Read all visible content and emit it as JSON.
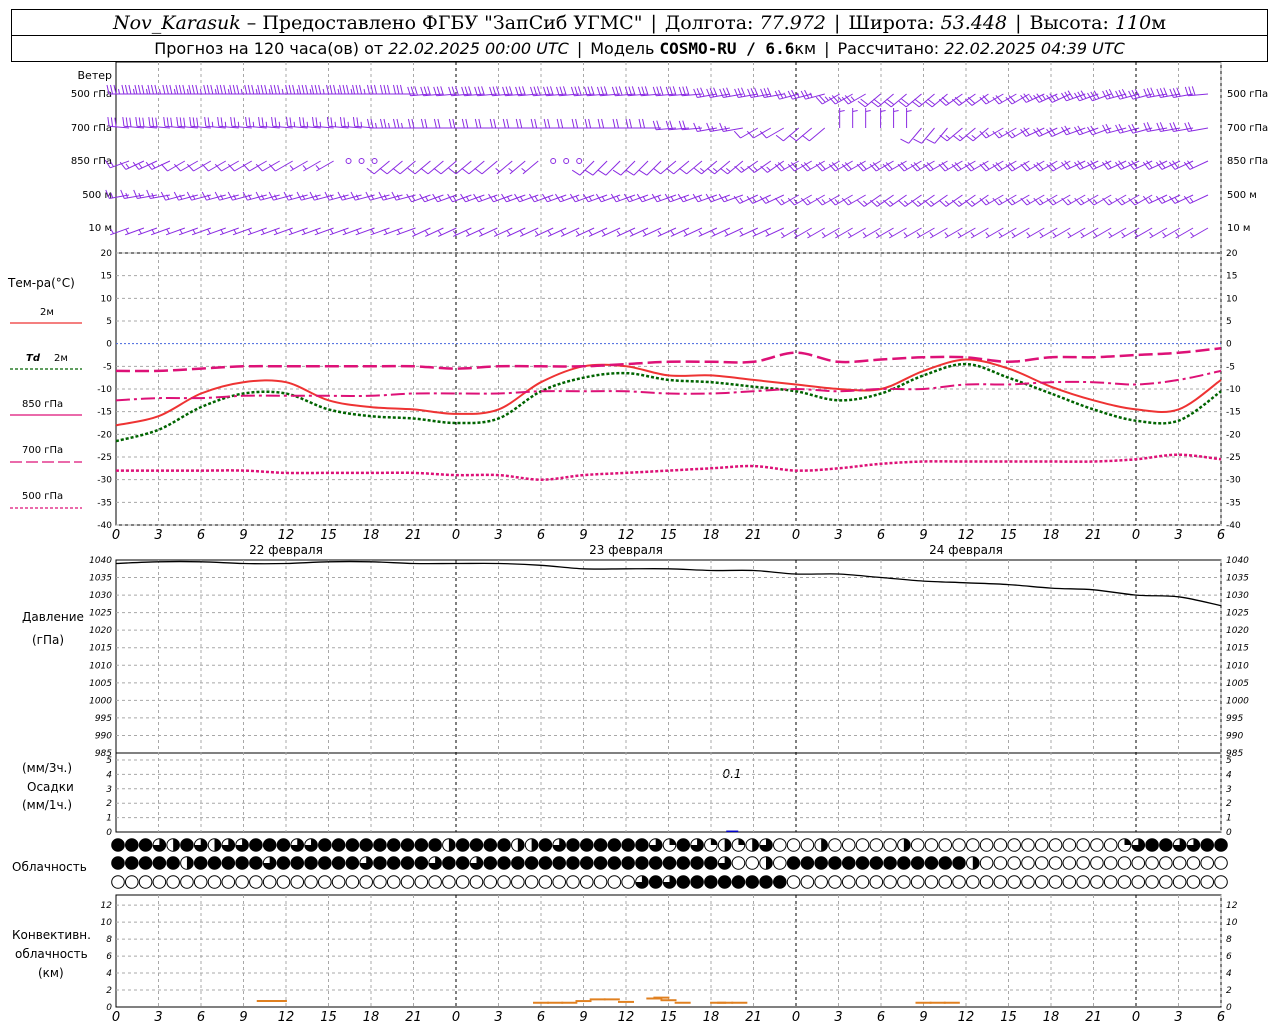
{
  "header": {
    "station": "Nov_Karasuk",
    "dash": " – ",
    "provider": "Предоставлено ФГБУ \"ЗапСиб УГМС\"",
    "lon_label": "Долгота:",
    "lon": "77.972",
    "lat_label": "Широта:",
    "lat": "53.448",
    "alt_label": "Высота:",
    "alt": "110",
    "alt_unit": "м",
    "forecast_prefix": "Прогноз на 120 часа(ов) от",
    "start_time": "22.02.2025 00:00 UTC",
    "model_label": "Модель",
    "model": "COSMO-RU / 6.6",
    "model_unit": "км",
    "calc_label": "Рассчитано:",
    "calc_time": "22.02.2025 04:39 UTC"
  },
  "labels": {
    "wind": "Ветер",
    "wind_levels": [
      "500 гПа",
      "700 гПа",
      "850 гПа",
      "500 м",
      "10 м"
    ],
    "temp_title": "Тем-ра(°С)",
    "t2m": "2м",
    "td_a": "Td",
    "td_b": "2м",
    "t850": "850 гПа",
    "t700": "700 гПа",
    "t500": "500 гПа",
    "pressure_a": "Давление",
    "pressure_b": "(гПа)",
    "precip_a": "(мм/3ч.)",
    "precip_b": "Осадки",
    "precip_c": "(мм/1ч.)",
    "precip_note": "0.1",
    "clouds": "Облачность",
    "conv_a": "Конвективн.",
    "conv_b": "облачность",
    "conv_c": "(км)"
  },
  "colors": {
    "wind": "#8a2be2",
    "t2m": "#ee3333",
    "td": "#006400",
    "t850": "#dd1177",
    "t700": "#dd1177",
    "t500": "#dd1177",
    "pressure": "#000000",
    "grid": "#a8a8a8",
    "convective": "#e08020",
    "precip": "#0000cc"
  },
  "time_axis": {
    "tick_labels": [
      "0",
      "3",
      "6",
      "9",
      "12",
      "15",
      "18",
      "21",
      "0",
      "3",
      "6",
      "9",
      "12",
      "15",
      "18",
      "21",
      "0",
      "3",
      "6",
      "9",
      "12",
      "15",
      "18",
      "21",
      "0",
      "3",
      "6"
    ],
    "dates": [
      "22 февраля",
      "23 февраля",
      "24 февраля"
    ]
  },
  "chart_data": [
    {
      "type": "line",
      "title": "Тем-ра(°С)",
      "x_unit": "hours from 22.02.2025 00:00 UTC",
      "ylim": [
        -40,
        20
      ],
      "yticks": [
        20,
        15,
        10,
        5,
        0,
        -5,
        -10,
        -15,
        -20,
        -25,
        -30,
        -35,
        -40
      ],
      "grid": true,
      "series": [
        {
          "name": "2м",
          "x": [
            0,
            3,
            6,
            9,
            12,
            15,
            18,
            21,
            24,
            27,
            30,
            33,
            36,
            39,
            42,
            45,
            48,
            51,
            54,
            57,
            60,
            63,
            66,
            69,
            72,
            75,
            78
          ],
          "values": [
            -18,
            -16,
            -11,
            -8.5,
            -8.5,
            -12.5,
            -14,
            -14.5,
            -15.5,
            -14.5,
            -8.5,
            -5,
            -5,
            -7,
            -7,
            -8,
            -9,
            -10,
            -10,
            -6,
            -3.5,
            -5.5,
            -9.5,
            -12.5,
            -14.5,
            -14.5,
            -8
          ]
        },
        {
          "name": "Td 2м",
          "x": [
            0,
            3,
            6,
            9,
            12,
            15,
            18,
            21,
            24,
            27,
            30,
            33,
            36,
            39,
            42,
            45,
            48,
            51,
            54,
            57,
            60,
            63,
            66,
            69,
            72,
            75,
            78
          ],
          "values": [
            -21.5,
            -19,
            -14,
            -11,
            -11,
            -14.5,
            -16,
            -16.5,
            -17.5,
            -16.5,
            -10.5,
            -7.5,
            -6.5,
            -8,
            -8.5,
            -9.5,
            -10.5,
            -12.5,
            -11,
            -7,
            -4.5,
            -7.5,
            -11,
            -14.5,
            -17,
            -17,
            -10.5
          ]
        },
        {
          "name": "850 гПа",
          "x": [
            0,
            3,
            6,
            9,
            12,
            15,
            18,
            21,
            24,
            27,
            30,
            33,
            36,
            39,
            42,
            45,
            48,
            51,
            54,
            57,
            60,
            63,
            66,
            69,
            72,
            75,
            78
          ],
          "values": [
            -12.5,
            -12,
            -12,
            -11.5,
            -11.5,
            -11.5,
            -11.5,
            -11,
            -11,
            -11,
            -10.5,
            -10.5,
            -10.5,
            -11,
            -11,
            -10.5,
            -10,
            -10.5,
            -10,
            -10,
            -9,
            -9,
            -8.5,
            -8.5,
            -9,
            -8,
            -6
          ]
        },
        {
          "name": "700 гПа",
          "x": [
            0,
            3,
            6,
            9,
            12,
            15,
            18,
            21,
            24,
            27,
            30,
            33,
            36,
            39,
            42,
            45,
            48,
            51,
            54,
            57,
            60,
            63,
            66,
            69,
            72,
            75,
            78
          ],
          "values": [
            -6,
            -6,
            -5.5,
            -5,
            -5,
            -5,
            -5,
            -5,
            -5.5,
            -5,
            -5,
            -5,
            -4.5,
            -4,
            -4,
            -4,
            -2,
            -4,
            -3.5,
            -3,
            -3,
            -4,
            -3,
            -3,
            -2.5,
            -2,
            -1
          ]
        },
        {
          "name": "500 гПа",
          "x": [
            0,
            3,
            6,
            9,
            12,
            15,
            18,
            21,
            24,
            27,
            30,
            33,
            36,
            39,
            42,
            45,
            48,
            51,
            54,
            57,
            60,
            63,
            66,
            69,
            72,
            75,
            78
          ],
          "values": [
            -28,
            -28,
            -28,
            -28,
            -28.5,
            -28.5,
            -28.5,
            -28.5,
            -29,
            -29,
            -30,
            -29,
            -28.5,
            -28,
            -27.5,
            -27,
            -28,
            -27.5,
            -26.5,
            -26,
            -26,
            -26,
            -26,
            -26,
            -25.5,
            -24.5,
            -25.5
          ]
        }
      ]
    },
    {
      "type": "line",
      "title": "Давление (гПа)",
      "ylim": [
        985,
        1040
      ],
      "yticks": [
        1040,
        1035,
        1030,
        1025,
        1020,
        1015,
        1010,
        1005,
        1000,
        995,
        990,
        985
      ],
      "grid": true,
      "series": [
        {
          "name": "Давление",
          "x": [
            0,
            3,
            6,
            9,
            12,
            15,
            18,
            21,
            24,
            27,
            30,
            33,
            36,
            39,
            42,
            45,
            48,
            51,
            54,
            57,
            60,
            63,
            66,
            69,
            72,
            75,
            78
          ],
          "values": [
            1039,
            1039.5,
            1039.5,
            1039,
            1039,
            1039.5,
            1039.5,
            1039,
            1039,
            1039,
            1038.5,
            1037.5,
            1037.5,
            1037.5,
            1037,
            1037,
            1036,
            1036,
            1035,
            1034,
            1033.5,
            1033,
            1032,
            1031.5,
            1030,
            1029.5,
            1027
          ]
        }
      ]
    },
    {
      "type": "bar",
      "title": "Осадки",
      "ylim": [
        0,
        5
      ],
      "yticks": [
        5,
        4,
        3,
        2,
        1,
        0
      ],
      "series": [
        {
          "name": "Осадки",
          "x": [
            43.5
          ],
          "values": [
            0.1
          ]
        }
      ]
    },
    {
      "type": "bar",
      "title": "Конвективн. облачность (км)",
      "ylim": [
        0,
        12
      ],
      "yticks": [
        12,
        10,
        8,
        6,
        4,
        2,
        0
      ],
      "series": [
        {
          "name": "Конвективная облачность",
          "x": [
            10.5,
            11.5,
            30,
            31,
            32,
            33,
            34,
            35,
            36,
            38,
            38.5,
            39,
            40,
            42.5,
            43,
            44,
            57,
            58,
            59
          ],
          "values": [
            0.7,
            0.7,
            0.5,
            0.5,
            0.5,
            0.7,
            0.9,
            0.9,
            0.6,
            1,
            1.1,
            0.8,
            0.5,
            0.5,
            0.5,
            0.5,
            0.5,
            0.5,
            0.5
          ]
        }
      ]
    }
  ],
  "wind_rows": [
    {
      "level": "500 гПа",
      "speed": [
        35,
        35,
        35,
        35,
        35,
        35,
        35,
        30,
        30,
        30,
        30,
        30,
        30,
        30,
        30,
        30,
        30,
        25,
        25,
        20,
        20,
        20,
        20,
        25,
        30,
        30,
        30,
        30
      ],
      "dir": [
        270,
        270,
        270,
        270,
        270,
        270,
        270,
        270,
        265,
        265,
        265,
        265,
        265,
        265,
        265,
        260,
        260,
        255,
        240,
        230,
        230,
        235,
        240,
        245,
        250,
        255,
        260,
        265
      ]
    },
    {
      "level": "700 гПа",
      "speed": [
        30,
        30,
        30,
        25,
        25,
        25,
        25,
        25,
        20,
        20,
        20,
        20,
        20,
        20,
        20,
        15,
        10,
        10,
        5,
        5,
        10,
        15,
        15,
        20,
        20,
        20,
        20,
        20
      ],
      "dir": [
        275,
        275,
        275,
        275,
        275,
        275,
        275,
        270,
        270,
        270,
        270,
        270,
        270,
        270,
        265,
        260,
        240,
        230,
        0,
        0,
        220,
        230,
        240,
        245,
        250,
        255,
        260,
        260
      ]
    },
    {
      "level": "850 гПа",
      "speed": [
        15,
        15,
        10,
        10,
        10,
        5,
        0,
        10,
        10,
        10,
        5,
        0,
        10,
        10,
        10,
        15,
        15,
        20,
        20,
        20,
        20,
        20,
        20,
        20,
        20,
        20,
        20,
        20
      ],
      "dir": [
        250,
        245,
        240,
        240,
        240,
        240,
        0,
        230,
        230,
        230,
        230,
        0,
        225,
        225,
        230,
        230,
        235,
        240,
        240,
        240,
        240,
        240,
        240,
        240,
        245,
        245,
        245,
        245
      ]
    },
    {
      "level": "500 м",
      "speed": [
        15,
        15,
        15,
        15,
        15,
        15,
        15,
        15,
        15,
        15,
        15,
        15,
        15,
        15,
        15,
        15,
        15,
        15,
        15,
        15,
        15,
        15,
        15,
        15,
        15,
        15,
        15,
        15
      ],
      "dir": [
        260,
        260,
        255,
        255,
        255,
        255,
        255,
        255,
        250,
        250,
        250,
        250,
        250,
        250,
        250,
        250,
        245,
        240,
        240,
        235,
        235,
        235,
        240,
        240,
        240,
        240,
        245,
        245
      ]
    },
    {
      "level": "10 м",
      "speed": [
        5,
        5,
        5,
        5,
        5,
        5,
        5,
        5,
        5,
        5,
        5,
        5,
        5,
        5,
        5,
        5,
        5,
        5,
        5,
        5,
        5,
        5,
        5,
        5,
        5,
        5,
        5,
        5
      ],
      "dir": [
        250,
        250,
        250,
        250,
        250,
        250,
        250,
        250,
        245,
        245,
        245,
        245,
        245,
        245,
        245,
        245,
        245,
        240,
        240,
        240,
        240,
        240,
        240,
        240,
        240,
        240,
        240,
        240
      ]
    }
  ],
  "cloud_rows": [
    [
      8,
      8,
      8,
      6,
      4,
      8,
      6,
      5,
      6,
      6,
      8,
      8,
      8,
      6,
      7,
      8,
      8,
      8,
      8,
      8,
      8,
      8,
      8,
      8,
      4,
      8,
      8,
      8,
      8,
      4,
      4,
      8,
      6,
      8,
      8,
      8,
      8,
      8,
      8,
      6,
      2,
      8,
      6,
      2,
      4,
      2,
      5,
      6,
      0,
      0,
      0,
      4,
      0,
      0,
      0,
      0,
      0,
      4,
      0,
      0,
      0,
      0,
      0,
      0,
      0,
      0,
      0,
      0,
      0,
      0,
      0,
      0,
      0,
      2,
      6,
      8,
      8,
      6,
      7,
      8,
      8
    ],
    [
      8,
      8,
      8,
      8,
      8,
      4,
      8,
      8,
      8,
      8,
      8,
      6,
      8,
      8,
      8,
      8,
      8,
      8,
      6,
      8,
      8,
      8,
      8,
      6,
      8,
      8,
      6,
      8,
      8,
      8,
      8,
      8,
      8,
      8,
      8,
      8,
      8,
      8,
      8,
      8,
      8,
      8,
      8,
      8,
      6,
      0,
      0,
      4,
      0,
      8,
      8,
      8,
      8,
      8,
      8,
      8,
      8,
      8,
      8,
      8,
      8,
      8,
      4,
      0,
      0,
      0,
      0,
      0,
      0,
      0,
      0,
      0,
      0,
      0,
      0,
      0,
      0,
      0,
      0,
      0,
      0
    ],
    [
      0,
      0,
      0,
      0,
      0,
      0,
      0,
      0,
      0,
      0,
      0,
      0,
      0,
      0,
      0,
      0,
      0,
      0,
      0,
      0,
      0,
      0,
      0,
      0,
      0,
      0,
      0,
      0,
      0,
      0,
      0,
      0,
      0,
      0,
      0,
      0,
      0,
      0,
      0,
      0,
      0,
      0,
      0,
      0,
      0,
      0,
      0,
      0,
      0,
      0,
      0,
      0,
      0,
      0,
      0,
      0,
      0,
      0,
      0,
      0,
      0,
      0,
      0,
      0,
      0,
      0,
      0,
      0,
      0,
      0,
      0,
      0,
      0,
      0,
      0,
      0,
      0,
      0,
      0,
      0,
      0
    ]
  ],
  "cloud_row3_dark_range": [
    38,
    48
  ]
}
